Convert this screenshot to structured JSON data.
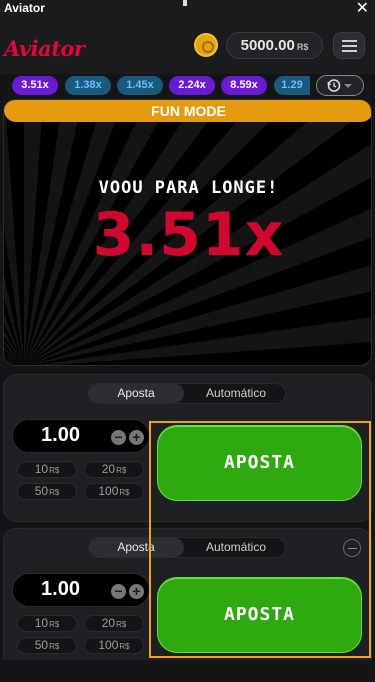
{
  "window": {
    "title": "Aviator",
    "close_label": "✕"
  },
  "header": {
    "logo": "Aviator",
    "balance": "5000.00",
    "currency": "R$",
    "icons": {
      "coin": "coin-icon",
      "menu": "hamburger-menu-icon"
    }
  },
  "history": {
    "multipliers": [
      {
        "value": "3.51x",
        "tone": "purple"
      },
      {
        "value": "1.38x",
        "tone": "blue"
      },
      {
        "value": "1.45x",
        "tone": "blue"
      },
      {
        "value": "2.24x",
        "tone": "purple"
      },
      {
        "value": "8.59x",
        "tone": "purple"
      },
      {
        "value": "1.29",
        "tone": "blue"
      }
    ],
    "icons": {
      "history": "clock-history-icon",
      "toggle": "chevron-down-icon"
    }
  },
  "game": {
    "mode_banner": "FUN MODE",
    "status": "VOOU PARA LONGE!",
    "multiplier": "3.51x"
  },
  "bet_panels": [
    {
      "tabs": [
        "Aposta",
        "Automático"
      ],
      "active_tab": "Aposta",
      "stake": "1.00",
      "minus": "−",
      "plus": "+",
      "quick_amounts": [
        {
          "amount": "10",
          "currency": "R$"
        },
        {
          "amount": "20",
          "currency": "R$"
        },
        {
          "amount": "50",
          "currency": "R$"
        },
        {
          "amount": "100",
          "currency": "R$"
        }
      ],
      "bet_button": "APOSTA"
    },
    {
      "tabs": [
        "Aposta",
        "Automático"
      ],
      "active_tab": "Aposta",
      "stake": "1.00",
      "minus": "−",
      "plus": "+",
      "quick_amounts": [
        {
          "amount": "10",
          "currency": "R$"
        },
        {
          "amount": "20",
          "currency": "R$"
        },
        {
          "amount": "50",
          "currency": "R$"
        },
        {
          "amount": "100",
          "currency": "R$"
        }
      ],
      "bet_button": "APOSTA"
    }
  ],
  "colors": {
    "accent_red": "#e50539",
    "banner_orange": "#e59b0f",
    "bet_green": "#2eaa10",
    "chip_purple": "#6a1ad4",
    "chip_blue": "#1c5a7d",
    "highlight_border": "#f1a31a"
  }
}
